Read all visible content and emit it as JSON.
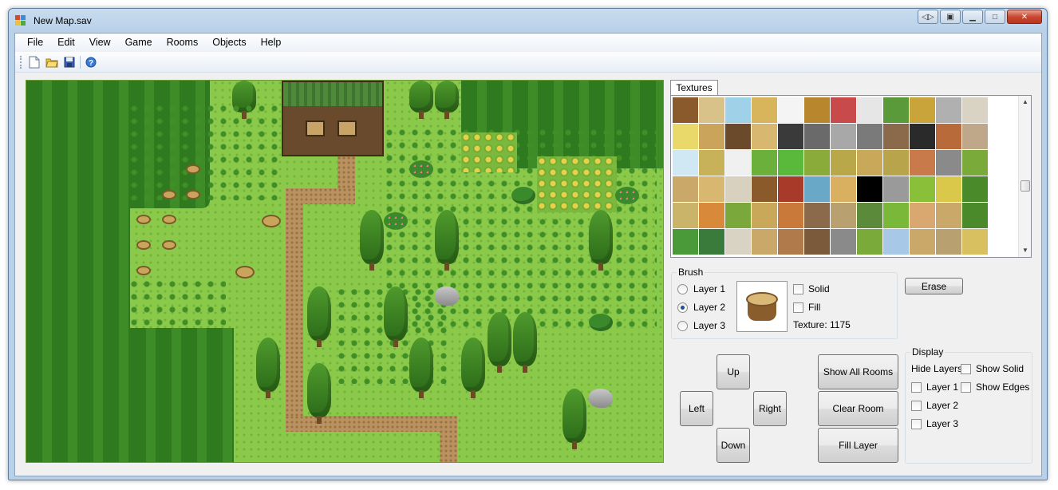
{
  "window": {
    "title": "New Map.sav",
    "close_glyph": "✕",
    "min_glyph": "▁",
    "max_glyph": "□"
  },
  "menu": [
    "File",
    "Edit",
    "View",
    "Game",
    "Rooms",
    "Objects",
    "Help"
  ],
  "toolbar": {
    "icons": [
      "new-file-icon",
      "open-folder-icon",
      "save-icon",
      "help-icon"
    ]
  },
  "textures": {
    "tab_label": "Textures",
    "scroll_up": "▲",
    "scroll_down": "▼"
  },
  "brush": {
    "label": "Brush",
    "layers": [
      {
        "label": "Layer 1",
        "selected": false
      },
      {
        "label": "Layer 2",
        "selected": true
      },
      {
        "label": "Layer 3",
        "selected": false
      }
    ],
    "solid_label": "Solid",
    "fill_label": "Fill",
    "texture_label": "Texture: 1175"
  },
  "erase_label": "Erase",
  "nav": {
    "up": "Up",
    "left": "Left",
    "right": "Right",
    "down": "Down"
  },
  "actions": {
    "show_all_rooms": "Show All Rooms",
    "clear_room": "Clear Room",
    "fill_layer": "Fill Layer"
  },
  "display": {
    "label": "Display",
    "hide_layers": "Hide Layers",
    "show_solid": "Show Solid",
    "show_edges": "Show Edges",
    "layer1": "Layer 1",
    "layer2": "Layer 2",
    "layer3": "Layer 3"
  },
  "colors": {
    "grass": "#8bc94a",
    "forest": "#2f7a1f",
    "path": "#b9925f",
    "accent_radio": "#1f4f96",
    "close_button": "#c94731"
  }
}
